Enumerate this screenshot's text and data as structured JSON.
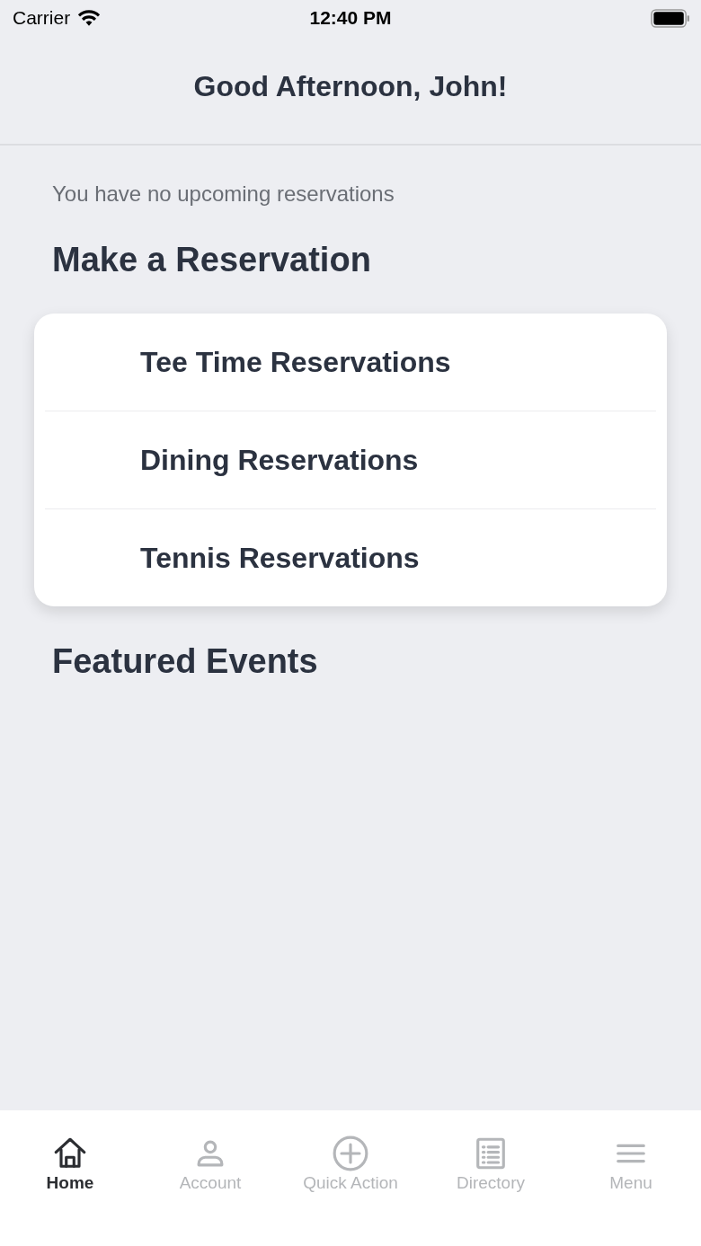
{
  "status_bar": {
    "carrier": "Carrier",
    "time": "12:40 PM"
  },
  "header": {
    "title": "Good Afternoon, John!"
  },
  "notice": "You have no upcoming reservations",
  "reservations": {
    "title": "Make a Reservation",
    "items": [
      {
        "label": "Tee Time Reservations"
      },
      {
        "label": "Dining Reservations"
      },
      {
        "label": "Tennis Reservations"
      }
    ]
  },
  "events": {
    "title": "Featured Events"
  },
  "tab_bar": [
    {
      "kind": "home",
      "label": "Home",
      "selected": true
    },
    {
      "kind": "account",
      "label": "Account",
      "selected": false
    },
    {
      "kind": "add",
      "label": "Quick Action",
      "selected": false
    },
    {
      "kind": "directory",
      "label": "Directory",
      "selected": false
    },
    {
      "kind": "menu",
      "label": "Menu",
      "selected": false
    }
  ]
}
